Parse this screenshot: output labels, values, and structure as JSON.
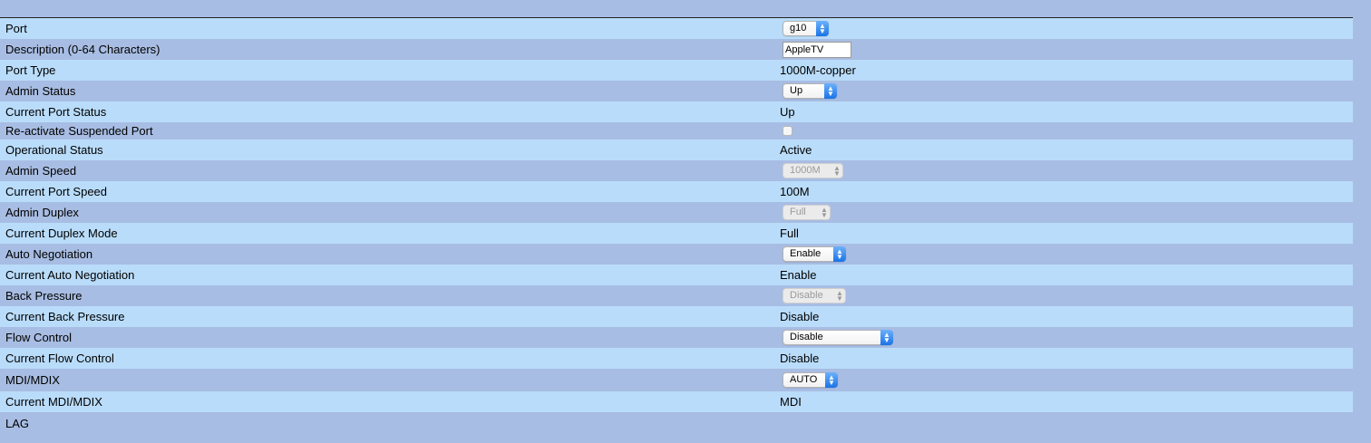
{
  "rows": {
    "port": {
      "label": "Port",
      "value": "g10"
    },
    "description": {
      "label": "Description (0-64 Characters)",
      "value": "AppleTV"
    },
    "port_type": {
      "label": "Port Type",
      "value": "1000M-copper"
    },
    "admin_status": {
      "label": "Admin Status",
      "value": "Up"
    },
    "current_port_status": {
      "label": "Current Port Status",
      "value": "Up"
    },
    "reactivate_suspended": {
      "label": "Re-activate Suspended Port",
      "checked": false
    },
    "operational_status": {
      "label": "Operational Status",
      "value": "Active"
    },
    "admin_speed": {
      "label": "Admin Speed",
      "value": "1000M",
      "disabled": true
    },
    "current_port_speed": {
      "label": "Current Port Speed",
      "value": "100M"
    },
    "admin_duplex": {
      "label": "Admin Duplex",
      "value": "Full",
      "disabled": true
    },
    "current_duplex_mode": {
      "label": "Current Duplex Mode",
      "value": "Full"
    },
    "auto_negotiation": {
      "label": "Auto Negotiation",
      "value": "Enable"
    },
    "current_auto_negotiation": {
      "label": "Current Auto Negotiation",
      "value": "Enable"
    },
    "back_pressure": {
      "label": "Back Pressure",
      "value": "Disable",
      "disabled": true
    },
    "current_back_pressure": {
      "label": "Current Back Pressure",
      "value": "Disable"
    },
    "flow_control": {
      "label": "Flow Control",
      "value": "Disable"
    },
    "current_flow_control": {
      "label": "Current Flow Control",
      "value": "Disable"
    },
    "mdi_mdix": {
      "label": "MDI/MDIX",
      "value": "AUTO"
    },
    "current_mdi_mdix": {
      "label": "Current MDI/MDIX",
      "value": "MDI"
    },
    "lag": {
      "label": "LAG"
    }
  },
  "colors": {
    "row_light": "#b9dcfa",
    "row_dark": "#a8bde3",
    "select_accent": "#1a73e8"
  }
}
